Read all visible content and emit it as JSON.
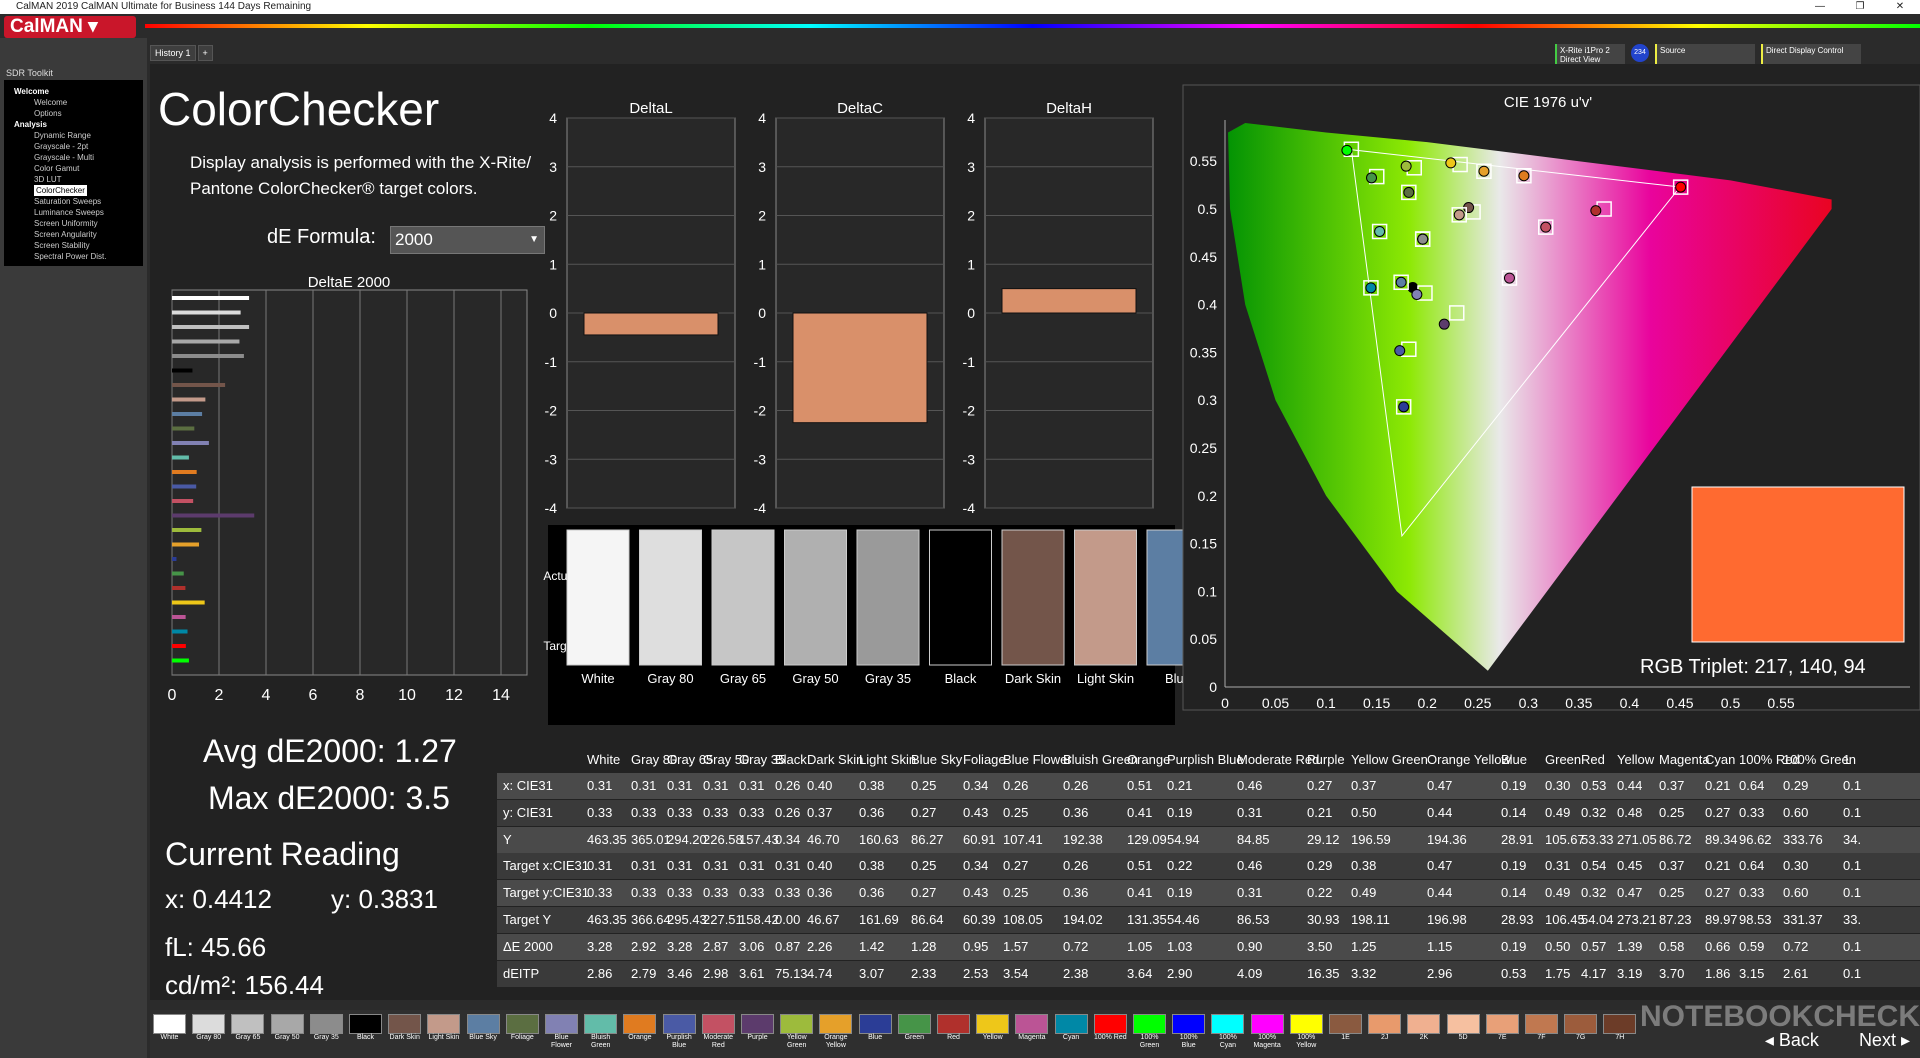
{
  "window": {
    "title": "CalMAN 2019 CalMAN Ultimate for Business 144 Days Remaining",
    "controls": [
      "—",
      "❐",
      "✕"
    ]
  },
  "logo": "CalMAN",
  "sidebar": {
    "header": "SDR Toolkit",
    "items": [
      {
        "label": "Welcome",
        "type": "section"
      },
      {
        "label": "Welcome",
        "type": "item"
      },
      {
        "label": "Options",
        "type": "item"
      },
      {
        "label": "Analysis",
        "type": "section"
      },
      {
        "label": "Dynamic Range",
        "type": "item"
      },
      {
        "label": "Grayscale - 2pt",
        "type": "item"
      },
      {
        "label": "Grayscale - Multi",
        "type": "item"
      },
      {
        "label": "Color Gamut",
        "type": "item"
      },
      {
        "label": "3D LUT",
        "type": "item"
      },
      {
        "label": "ColorChecker",
        "type": "item",
        "selected": true
      },
      {
        "label": "Saturation Sweeps",
        "type": "item"
      },
      {
        "label": "Luminance Sweeps",
        "type": "item"
      },
      {
        "label": "Screen Uniformity",
        "type": "item"
      },
      {
        "label": "Screen Angularity",
        "type": "item"
      },
      {
        "label": "Screen Stability",
        "type": "item"
      },
      {
        "label": "Spectral Power Dist.",
        "type": "item"
      }
    ]
  },
  "tabs": [
    "History 1",
    "+"
  ],
  "toolbar": {
    "meter": "X-Rite i1Pro 2\nDirect View",
    "meter_badge": "234",
    "source": "Source",
    "display": "Direct Display Control"
  },
  "page": {
    "title": "ColorChecker",
    "description": "Display analysis is performed with the X-Rite/ Pantone ColorChecker® target colors.",
    "formula_label": "dE Formula:",
    "formula_value": "2000"
  },
  "stats": {
    "avg": "Avg dE2000: 1.27",
    "max": "Max dE2000: 3.5",
    "current_reading": "Current Reading",
    "x": "x: 0.4412",
    "y": "y: 0.3831",
    "fl": "fL: 45.66",
    "cdm2": "cd/m²: 156.44"
  },
  "deltae_chart": {
    "title": "DeltaE 2000",
    "ticks": [
      "0",
      "2",
      "4",
      "6",
      "8",
      "10",
      "12",
      "14"
    ]
  },
  "delta_charts": [
    {
      "title": "DeltaL",
      "value": -0.45
    },
    {
      "title": "DeltaC",
      "value": -2.25
    },
    {
      "title": "DeltaH",
      "value": 0.5
    }
  ],
  "delta_ticks": [
    "4",
    "3",
    "2",
    "1",
    "0",
    "-1",
    "-2",
    "-3",
    "-4"
  ],
  "swatch_strip": {
    "actual_label": "Actual",
    "target_label": "Target",
    "items": [
      {
        "name": "White",
        "color": "#f5f5f5"
      },
      {
        "name": "Gray 80",
        "color": "#dedede"
      },
      {
        "name": "Gray 65",
        "color": "#c6c6c6"
      },
      {
        "name": "Gray 50",
        "color": "#b0b0b0"
      },
      {
        "name": "Gray 35",
        "color": "#9a9a9a"
      },
      {
        "name": "Black",
        "color": "#000000"
      },
      {
        "name": "Dark Skin",
        "color": "#73554a"
      },
      {
        "name": "Light Skin",
        "color": "#c39a8a"
      },
      {
        "name": "Blue",
        "color": "#5c7ea3"
      }
    ]
  },
  "cie": {
    "title": "CIE 1976 u'v'",
    "xticks": [
      "0",
      "0.05",
      "0.1",
      "0.15",
      "0.2",
      "0.25",
      "0.3",
      "0.35",
      "0.4",
      "0.45",
      "0.5",
      "0.55"
    ],
    "yticks": [
      "0.55",
      "0.5",
      "0.45",
      "0.4",
      "0.35",
      "0.3",
      "0.25",
      "0.2",
      "0.15",
      "0.1",
      "0.05",
      "0"
    ],
    "rgb_triplet": "RGB Triplet: 217, 140, 94"
  },
  "table": {
    "columns": [
      "White",
      "Gray 80",
      "Gray 65",
      "Gray 50",
      "Gray 35",
      "Black",
      "Dark Skin",
      "Light Skin",
      "Blue Sky",
      "Foliage",
      "Blue Flower",
      "Bluish Green",
      "Orange",
      "Purplish Blue",
      "Moderate Red",
      "Purple",
      "Yellow Green",
      "Orange Yellow",
      "Blue",
      "Green",
      "Red",
      "Yellow",
      "Magenta",
      "Cyan",
      "100% Red",
      "100% Green",
      "1"
    ],
    "rows": [
      {
        "label": "x: CIE31",
        "values": [
          "0.31",
          "0.31",
          "0.31",
          "0.31",
          "0.31",
          "0.26",
          "0.40",
          "0.38",
          "0.25",
          "0.34",
          "0.26",
          "0.26",
          "0.51",
          "0.21",
          "0.46",
          "0.27",
          "0.37",
          "0.47",
          "0.19",
          "0.30",
          "0.53",
          "0.44",
          "0.37",
          "0.21",
          "0.64",
          "0.29",
          "0.1"
        ]
      },
      {
        "label": "y: CIE31",
        "values": [
          "0.33",
          "0.33",
          "0.33",
          "0.33",
          "0.33",
          "0.26",
          "0.37",
          "0.36",
          "0.27",
          "0.43",
          "0.25",
          "0.36",
          "0.41",
          "0.19",
          "0.31",
          "0.21",
          "0.50",
          "0.44",
          "0.14",
          "0.49",
          "0.32",
          "0.48",
          "0.25",
          "0.27",
          "0.33",
          "0.60",
          "0.1"
        ]
      },
      {
        "label": "Y",
        "values": [
          "463.35",
          "365.01",
          "294.20",
          "226.58",
          "157.43",
          "0.34",
          "46.70",
          "160.63",
          "86.27",
          "60.91",
          "107.41",
          "192.38",
          "129.09",
          "54.94",
          "84.85",
          "29.12",
          "196.59",
          "194.36",
          "28.91",
          "105.67",
          "53.33",
          "271.05",
          "86.72",
          "89.34",
          "96.62",
          "333.76",
          "34."
        ]
      },
      {
        "label": "Target x:CIE31",
        "values": [
          "0.31",
          "0.31",
          "0.31",
          "0.31",
          "0.31",
          "0.31",
          "0.40",
          "0.38",
          "0.25",
          "0.34",
          "0.27",
          "0.26",
          "0.51",
          "0.22",
          "0.46",
          "0.29",
          "0.38",
          "0.47",
          "0.19",
          "0.31",
          "0.54",
          "0.45",
          "0.37",
          "0.21",
          "0.64",
          "0.30",
          "0.1"
        ]
      },
      {
        "label": "Target y:CIE31",
        "values": [
          "0.33",
          "0.33",
          "0.33",
          "0.33",
          "0.33",
          "0.33",
          "0.36",
          "0.36",
          "0.27",
          "0.43",
          "0.25",
          "0.36",
          "0.41",
          "0.19",
          "0.31",
          "0.22",
          "0.49",
          "0.44",
          "0.14",
          "0.49",
          "0.32",
          "0.47",
          "0.25",
          "0.27",
          "0.33",
          "0.60",
          "0.1"
        ]
      },
      {
        "label": "Target Y",
        "values": [
          "463.35",
          "366.64",
          "295.43",
          "227.51",
          "158.42",
          "0.00",
          "46.67",
          "161.69",
          "86.64",
          "60.39",
          "108.05",
          "194.02",
          "131.35",
          "54.46",
          "86.53",
          "30.93",
          "198.11",
          "196.98",
          "28.93",
          "106.45",
          "54.04",
          "273.21",
          "87.23",
          "89.97",
          "98.53",
          "331.37",
          "33."
        ]
      },
      {
        "label": "ΔE 2000",
        "values": [
          "3.28",
          "2.92",
          "3.28",
          "2.87",
          "3.06",
          "0.87",
          "2.26",
          "1.42",
          "1.28",
          "0.95",
          "1.57",
          "0.72",
          "1.05",
          "1.03",
          "0.90",
          "3.50",
          "1.25",
          "1.15",
          "0.19",
          "0.50",
          "0.57",
          "1.39",
          "0.58",
          "0.66",
          "0.59",
          "0.72",
          "0.1"
        ]
      },
      {
        "label": "dEITP",
        "values": [
          "2.86",
          "2.79",
          "3.46",
          "2.98",
          "3.61",
          "75.13",
          "4.74",
          "3.07",
          "2.33",
          "2.53",
          "3.54",
          "2.38",
          "3.64",
          "2.90",
          "4.09",
          "16.35",
          "3.32",
          "2.96",
          "0.53",
          "1.75",
          "4.17",
          "3.19",
          "3.70",
          "1.86",
          "3.15",
          "2.61",
          "0.1"
        ]
      }
    ]
  },
  "bottom_swatches": [
    {
      "label": "White",
      "color": "#ffffff"
    },
    {
      "label": "Gray 80",
      "color": "#dcdcdc"
    },
    {
      "label": "Gray 65",
      "color": "#c0c0c0"
    },
    {
      "label": "Gray 50",
      "color": "#a8a8a8"
    },
    {
      "label": "Gray 35",
      "color": "#8c8c8c"
    },
    {
      "label": "Black",
      "color": "#000000"
    },
    {
      "label": "Dark Skin",
      "color": "#73554a"
    },
    {
      "label": "Light Skin",
      "color": "#c39a8a"
    },
    {
      "label": "Blue Sky",
      "color": "#5c7ea3"
    },
    {
      "label": "Foliage",
      "color": "#5b6e41"
    },
    {
      "label": "Blue Flower",
      "color": "#8181b3"
    },
    {
      "label": "Bluish Green",
      "color": "#62bca9"
    },
    {
      "label": "Orange",
      "color": "#e07b20"
    },
    {
      "label": "Purplish Blue",
      "color": "#4a5aa5"
    },
    {
      "label": "Moderate Red",
      "color": "#c35163"
    },
    {
      "label": "Purple",
      "color": "#5c3b6c"
    },
    {
      "label": "Yellow Green",
      "color": "#9dbb3c"
    },
    {
      "label": "Orange Yellow",
      "color": "#e5a02a"
    },
    {
      "label": "Blue",
      "color": "#2b3d96"
    },
    {
      "label": "Green",
      "color": "#469448"
    },
    {
      "label": "Red",
      "color": "#b0302c"
    },
    {
      "label": "Yellow",
      "color": "#eec719"
    },
    {
      "label": "Magenta",
      "color": "#bb5495"
    },
    {
      "label": "Cyan",
      "color": "#0088a6"
    },
    {
      "label": "100% Red",
      "color": "#ff0000"
    },
    {
      "label": "100% Green",
      "color": "#00ff00"
    },
    {
      "label": "100% Blue",
      "color": "#0000ff"
    },
    {
      "label": "100% Cyan",
      "color": "#00ffff"
    },
    {
      "label": "100% Magenta",
      "color": "#ff00ff"
    },
    {
      "label": "100% Yellow",
      "color": "#ffff00"
    },
    {
      "label": "1E",
      "color": "#8a5a40"
    },
    {
      "label": "2J",
      "color": "#e89a6c"
    },
    {
      "label": "2K",
      "color": "#f0b090"
    },
    {
      "label": "5D",
      "color": "#f6c0a0"
    },
    {
      "label": "7E",
      "color": "#e8a078"
    },
    {
      "label": "7F",
      "color": "#c07850"
    },
    {
      "label": "7G",
      "color": "#9c5c3c"
    },
    {
      "label": "7H",
      "color": "#6c3c28"
    }
  ],
  "nav": {
    "back": "Back",
    "next": "Next"
  },
  "watermark": "NOTEBOOKCHECK"
}
